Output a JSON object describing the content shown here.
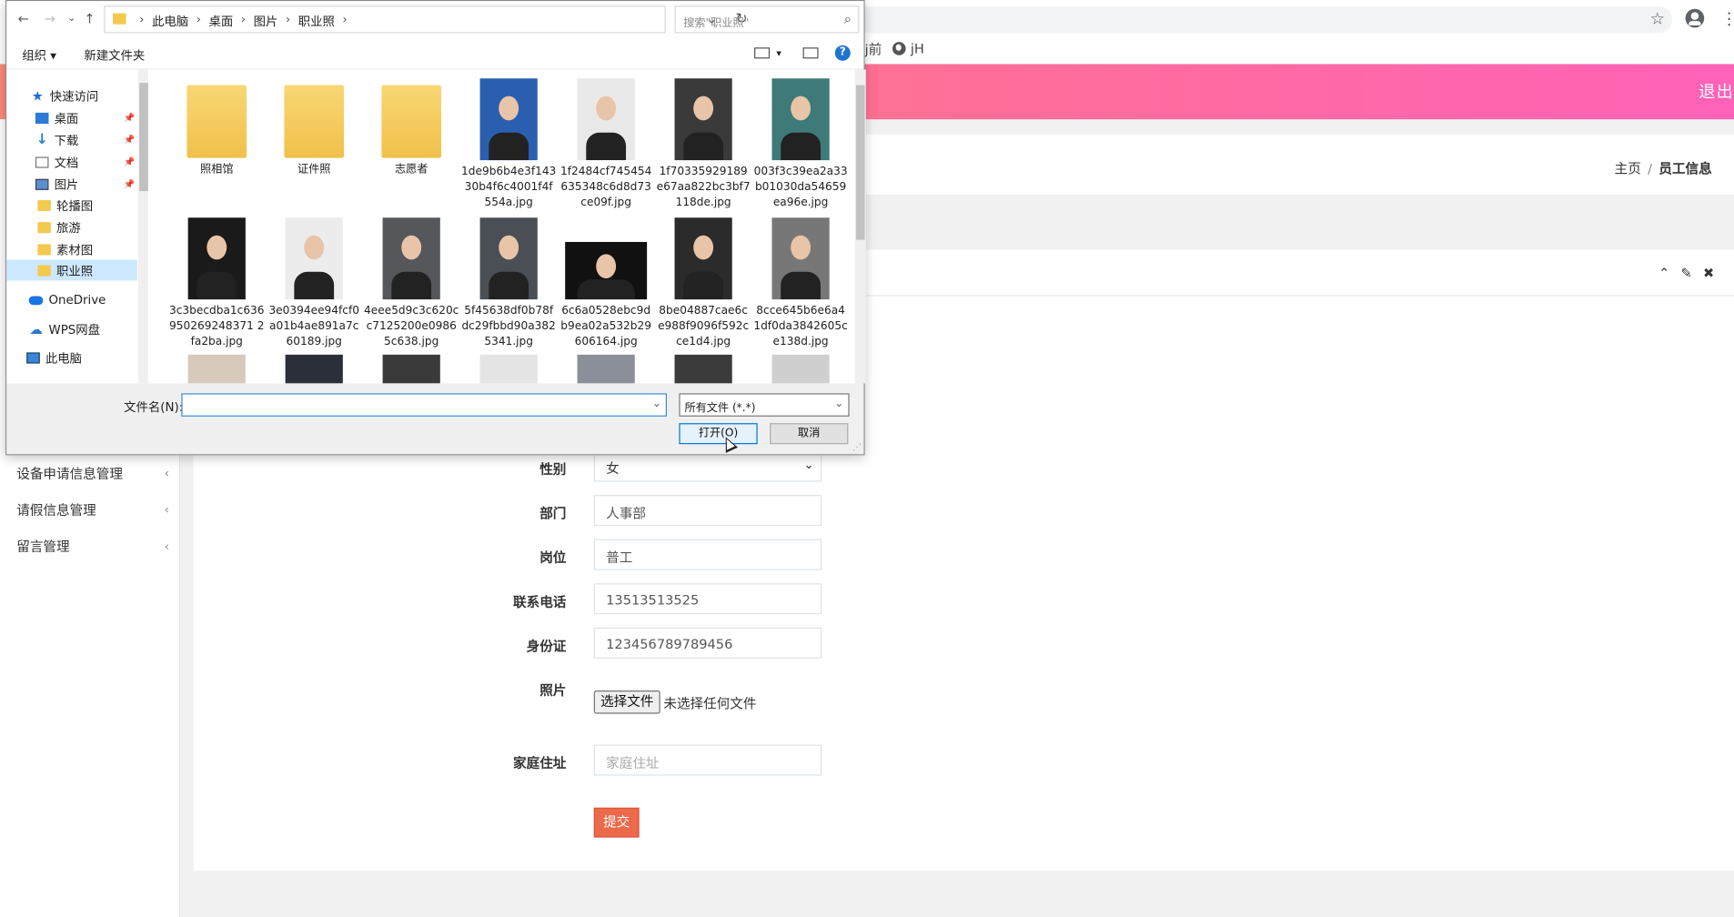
{
  "browser": {
    "bookmarks": [
      "j前",
      "jH"
    ]
  },
  "header": {
    "logout_label": "退出"
  },
  "sidebar": {
    "items": [
      {
        "label": "设备申请信息管理"
      },
      {
        "label": "请假信息管理"
      },
      {
        "label": "留言管理"
      }
    ]
  },
  "breadcrumb": {
    "home": "主页",
    "current": "员工信息"
  },
  "form": {
    "gender": {
      "label": "性别",
      "value": "女"
    },
    "department": {
      "label": "部门",
      "value": "人事部"
    },
    "position": {
      "label": "岗位",
      "value": "普工"
    },
    "phone": {
      "label": "联系电话",
      "value": "13513513525"
    },
    "id_card": {
      "label": "身份证",
      "value": "123456789789456"
    },
    "photo": {
      "label": "照片",
      "button": "选择文件",
      "status": "未选择任何文件"
    },
    "address": {
      "label": "家庭住址",
      "placeholder": "家庭住址"
    },
    "submit_label": "提交"
  },
  "dialog": {
    "path": [
      "此电脑",
      "桌面",
      "图片",
      "职业照"
    ],
    "search_placeholder": "搜索\"职业照\"",
    "organize_label": "组织 ▾",
    "new_folder_label": "新建文件夹",
    "tree": [
      {
        "label": "快速访问",
        "icon": "star-icon"
      },
      {
        "label": "桌面",
        "icon": "desktop-icon",
        "pinned": true
      },
      {
        "label": "下载",
        "icon": "download-icon",
        "pinned": true
      },
      {
        "label": "文档",
        "icon": "document-icon",
        "pinned": true
      },
      {
        "label": "图片",
        "icon": "pictures-icon",
        "pinned": true
      },
      {
        "label": "轮播图",
        "icon": "folder-icon"
      },
      {
        "label": "旅游",
        "icon": "folder-icon"
      },
      {
        "label": "素材图",
        "icon": "folder-icon"
      },
      {
        "label": "职业照",
        "icon": "folder-icon",
        "selected": true
      },
      {
        "label": "OneDrive",
        "icon": "onedrive-icon"
      },
      {
        "label": "WPS网盘",
        "icon": "wps-cloud-icon"
      },
      {
        "label": "此电脑",
        "icon": "computer-icon"
      }
    ],
    "files": [
      {
        "name": "照相馆",
        "kind": "folder"
      },
      {
        "name": "证件照",
        "kind": "folder"
      },
      {
        "name": "志愿者",
        "kind": "folder"
      },
      {
        "name": "1de9b6b4e3f14330b4f6c4001f4f554a.jpg",
        "kind": "photo",
        "bg": "#2a5fb0"
      },
      {
        "name": "1f2484cf745454635348c6d8d73ce09f.jpg",
        "kind": "photo",
        "bg": "#e9e9e9"
      },
      {
        "name": "1f70335929189e67aa822bc3bf7118de.jpg",
        "kind": "photo",
        "bg": "#3a3a3a"
      },
      {
        "name": "003f3c39ea2a33b01030da54659ea96e.jpg",
        "kind": "photo",
        "bg": "#3d7a78"
      },
      {
        "name": "3c3becdba1c636950269248371 2fa2ba.jpg",
        "kind": "photo",
        "bg": "#1a1a1a"
      },
      {
        "name": "3e0394ee94fcf0a01b4ae891a7c60189.jpg",
        "kind": "photo",
        "bg": "#ececec"
      },
      {
        "name": "4eee5d9c3c620cc7125200e09865c638.jpg",
        "kind": "photo",
        "bg": "#55575b"
      },
      {
        "name": "5f45638df0b78fdc29fbbd90a3825341.jpg",
        "kind": "photo",
        "bg": "#4a4f56"
      },
      {
        "name": "6c6a0528ebc9db9ea02a532b29606164.jpg",
        "kind": "photo",
        "bg": "#111111"
      },
      {
        "name": "8be04887cae6ce988f9096f592cce1d4.jpg",
        "kind": "photo",
        "bg": "#2b2b2b"
      },
      {
        "name": "8cce645b6e6a41df0da3842605ce138d.jpg",
        "kind": "photo",
        "bg": "#777777"
      }
    ],
    "filename_label": "文件名(N):",
    "filename_value": "",
    "filetype_value": "所有文件 (*.*)",
    "open_label": "打开(O)",
    "cancel_label": "取消"
  }
}
